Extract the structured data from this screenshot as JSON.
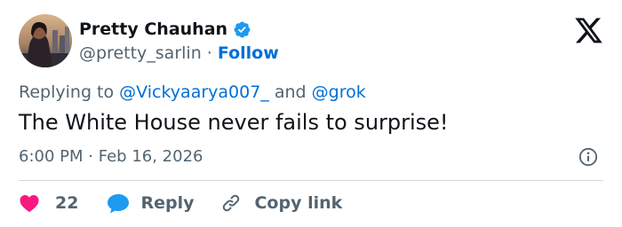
{
  "author": {
    "name": "Pretty Chauhan",
    "handle": "@pretty_sarlin",
    "separator": "·",
    "follow_label": "Follow",
    "verified_icon": "verified-badge-icon",
    "avatar_icon": "avatar-photo"
  },
  "reply_context": {
    "prefix": "Replying to",
    "mention_1": "@Vickyaarya007_",
    "conjunction": "and",
    "mention_2": "@grok"
  },
  "tweet": {
    "text": "The White House never fails to surprise!",
    "time": "6:00 PM",
    "separator": "·",
    "date": "Feb 16, 2026"
  },
  "actions": {
    "like_count": "22",
    "reply_label": "Reply",
    "copy_link_label": "Copy link"
  },
  "colors": {
    "accent": "#006fd6",
    "verified": "#1d9bf0",
    "like": "#f91880",
    "text": "#0f1419",
    "secondary": "#536471",
    "divider": "#cfd9de"
  },
  "icons": {
    "logo": "x-logo-icon",
    "info": "info-icon",
    "like": "heart-icon",
    "reply": "speech-bubble-icon",
    "copy": "link-icon"
  }
}
